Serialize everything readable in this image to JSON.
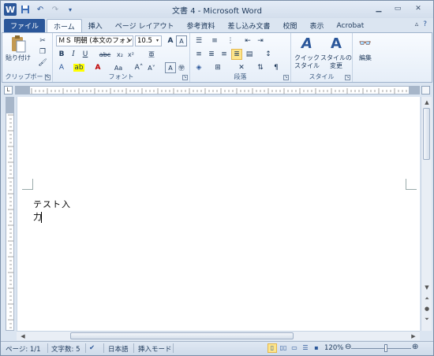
{
  "window": {
    "title": "文書 4 - Microsoft Word"
  },
  "qat": {
    "logo": "W",
    "icons": [
      "save-icon",
      "undo-icon",
      "redo-icon",
      "customize-icon"
    ]
  },
  "ribbon_tabs": [
    "ファイル",
    "ホーム",
    "挿入",
    "ページ レイアウト",
    "参考資料",
    "差し込み文書",
    "校閲",
    "表示",
    "Acrobat"
  ],
  "active_tab": "ホーム",
  "groups": {
    "clipboard": {
      "label": "クリップボード",
      "paste": "貼り付け"
    },
    "font": {
      "label": "フォント",
      "font_name": "ＭＳ 明朝 (本文のフォン",
      "font_size": "10.5"
    },
    "paragraph": {
      "label": "段落"
    },
    "style": {
      "label": "スタイル",
      "quick_style": "クイック\nスタイル",
      "change_style": "スタイルの\n変更"
    },
    "edit": {
      "label": "編集"
    }
  },
  "document": {
    "text": "テスト入力"
  },
  "status": {
    "page": "ページ: 1/1",
    "words": "文字数: 5",
    "language": "日本語",
    "mode": "挿入モード",
    "zoom": "120%",
    "zoom_level": 120
  },
  "colors": {
    "accent": "#2b579a",
    "ribbon_bg": "#dbe5f1",
    "highlight": "#fde58b"
  }
}
